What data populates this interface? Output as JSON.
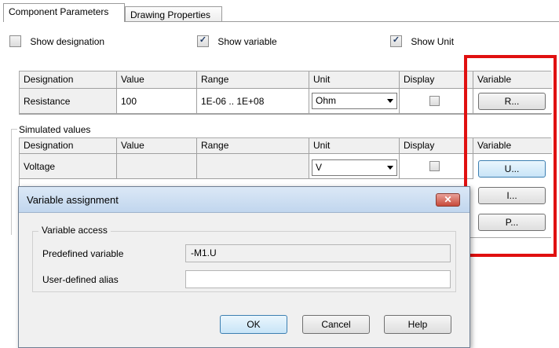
{
  "tabs": [
    {
      "label": "Component Parameters"
    },
    {
      "label": "Drawing Properties"
    }
  ],
  "options": {
    "show_designation": {
      "label": "Show designation",
      "checked": false
    },
    "show_variable": {
      "label": "Show variable",
      "checked": true
    },
    "show_unit": {
      "label": "Show Unit",
      "checked": true
    }
  },
  "params_table": {
    "headers": [
      "Designation",
      "Value",
      "Range",
      "Unit",
      "Display",
      "Variable"
    ],
    "row": {
      "designation": "Resistance",
      "value": "100",
      "range": "1E-06 .. 1E+08",
      "unit": "Ohm",
      "display": false,
      "variable_button": "R..."
    }
  },
  "simulated": {
    "label": "Simulated values",
    "headers": [
      "Designation",
      "Value",
      "Range",
      "Unit",
      "Display",
      "Variable"
    ],
    "row": {
      "designation": "Voltage",
      "value": "",
      "range": "",
      "unit": "V",
      "display": false
    },
    "variable_buttons": [
      "U...",
      "I...",
      "P..."
    ]
  },
  "dialog": {
    "title": "Variable assignment",
    "close_label": "✕",
    "group_label": "Variable access",
    "predefined_label": "Predefined variable",
    "predefined_value": "-M1.U",
    "alias_label": "User-defined alias",
    "alias_value": "",
    "ok_label": "OK",
    "cancel_label": "Cancel",
    "help_label": "Help"
  },
  "colors": {
    "highlight_box": "#e01010"
  }
}
